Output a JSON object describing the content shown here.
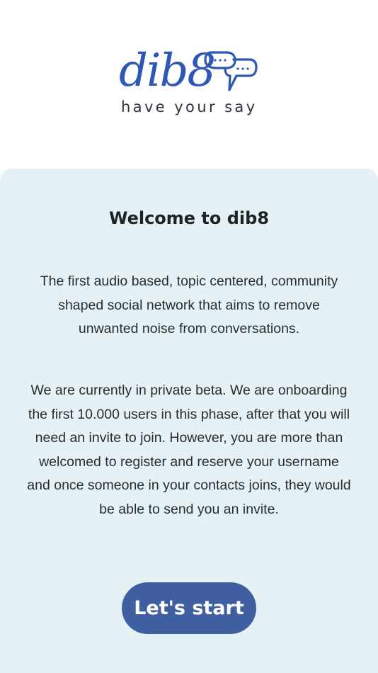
{
  "logo": {
    "wordmark": "dib8",
    "tagline": "have your say",
    "icon": "speech-bubbles-icon",
    "color": "#2f57b6"
  },
  "card": {
    "title": "Welcome to dib8",
    "paragraph_1": "The first audio based, topic centered, community shaped social network that aims to remove unwanted noise from conversations.",
    "paragraph_2": "We are currently in private beta. We are onboarding the first 10.000 users in this phase, after that you will need an invite to join. However, you are more than welcomed to register and reserve your username and once someone in your contacts joins, they would be able to send you an invite.",
    "background": "#e4f1f5"
  },
  "actions": {
    "start_label": "Let's start",
    "button_color": "#3f5fa0"
  }
}
